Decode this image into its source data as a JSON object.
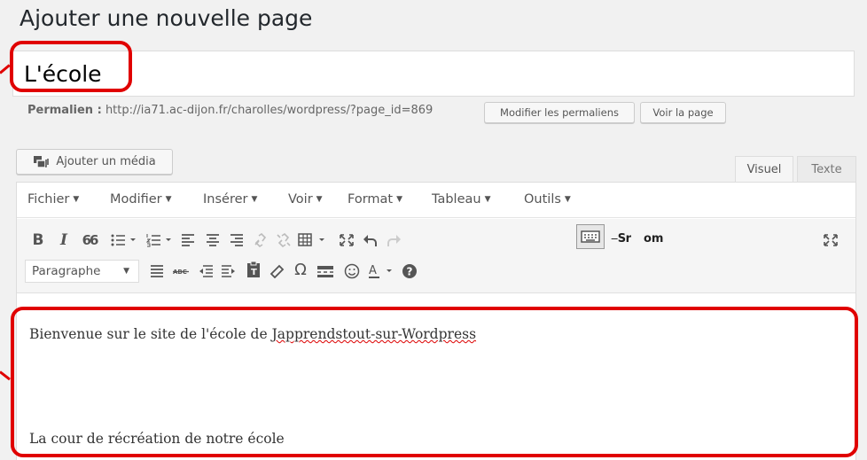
{
  "header": {
    "title": "Ajouter une nouvelle page"
  },
  "title_field": {
    "value": "L'école"
  },
  "permalink": {
    "label": "Permalien :",
    "url": "http://ia71.ac-dijon.fr/charolles/wordpress/?page_id=869",
    "edit_button": "Modifier les permaliens",
    "view_button": "Voir la page"
  },
  "media": {
    "add_media_label": "Ajouter un média"
  },
  "tabs": {
    "visual": "Visuel",
    "text": "Texte"
  },
  "menubar": {
    "file": "Fichier",
    "edit": "Modifier",
    "insert": "Insérer",
    "view": "Voir",
    "format": "Format",
    "table": "Tableau",
    "tools": "Outils"
  },
  "toolbar": {
    "bold": "B",
    "italic": "I",
    "quote": "66",
    "special_text": "Sr",
    "special_text2": "om",
    "omega": "Ω",
    "format_select": "Paragraphe",
    "help": "?"
  },
  "content": {
    "paragraph1_prefix": "Bienvenue sur le site de l'école de ",
    "paragraph1_misspelled": "Japprendstout-sur-Wordpress",
    "paragraph2": "La cour de récréation de notre école"
  },
  "colors": {
    "highlight": "#e00000",
    "accent": "#0073aa"
  }
}
